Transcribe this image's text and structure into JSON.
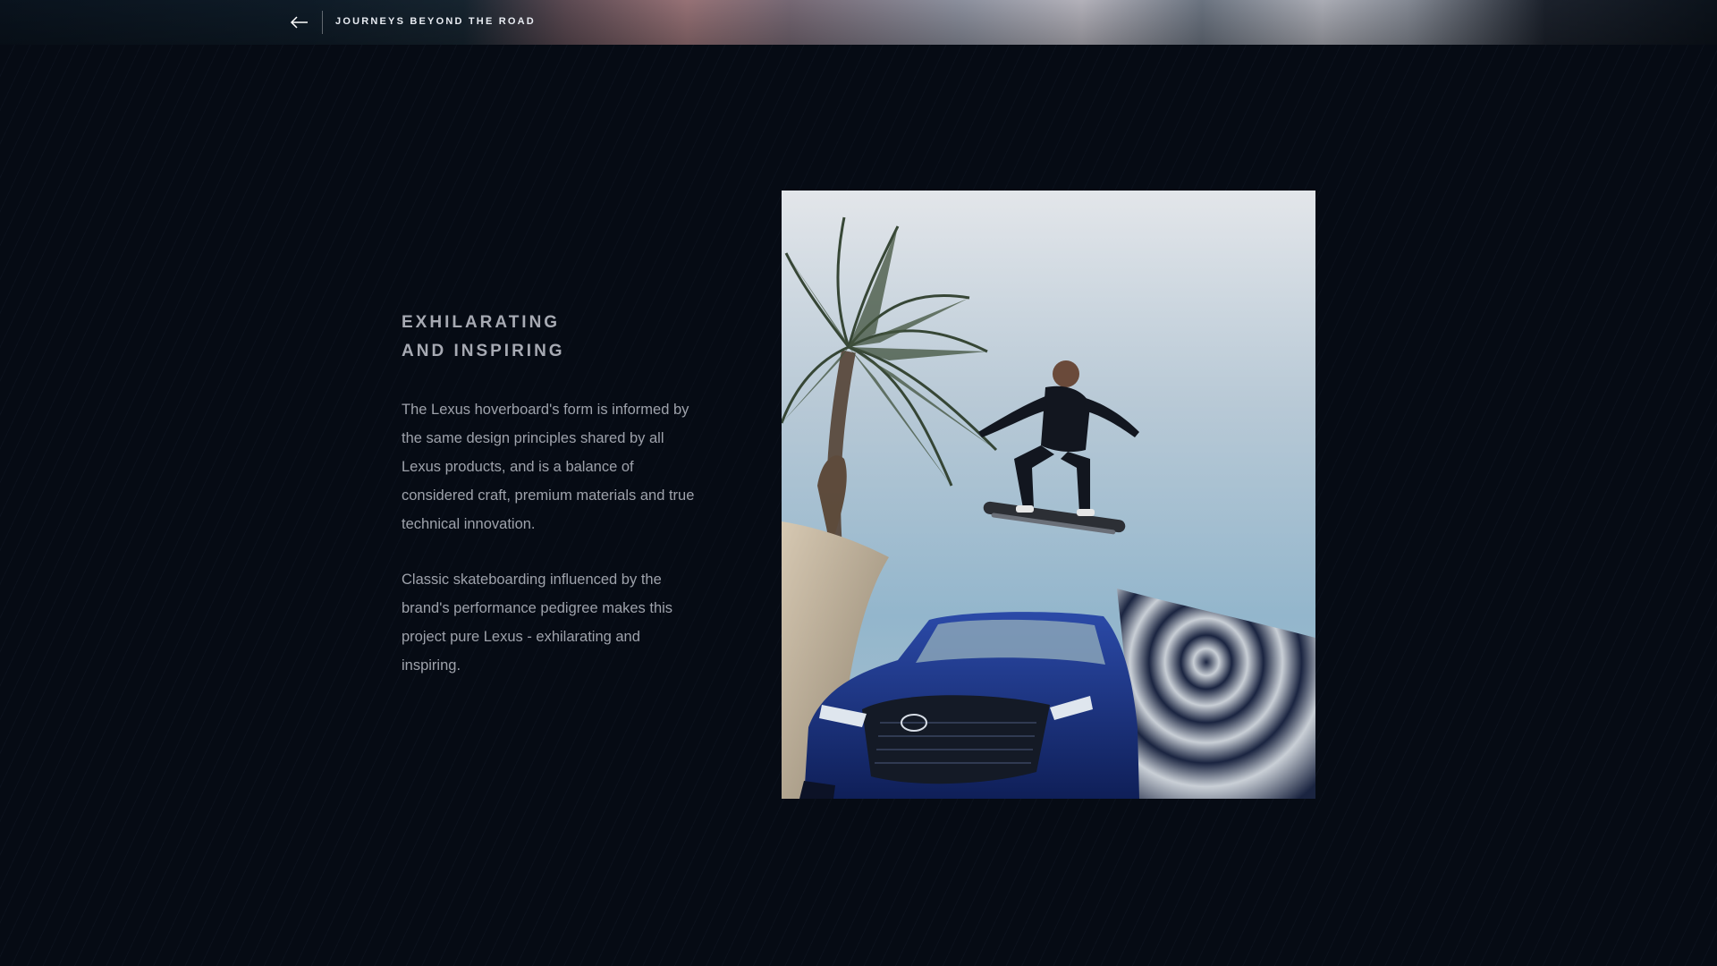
{
  "header": {
    "back_icon": "arrow-left-icon",
    "title": "JOURNEYS BEYOND THE ROAD"
  },
  "content": {
    "heading_line1": "EXHILARATING",
    "heading_line2": "AND INSPIRING",
    "paragraph1": "The Lexus hoverboard's form is informed by the same design principles shared by all Lexus products, and is a balance of considered craft, premium materials and true technical innovation.",
    "paragraph2": "Classic skateboarding influenced by the brand's performance pedigree makes this project pure Lexus - exhilarating and inspiring."
  },
  "image": {
    "subject": "hoverboard-rider-over-lexus-car"
  },
  "colors": {
    "background": "#060b14",
    "heading": "#a7aab3",
    "body_text": "#9ea2ab",
    "car_blue": "#1f3a8c"
  }
}
